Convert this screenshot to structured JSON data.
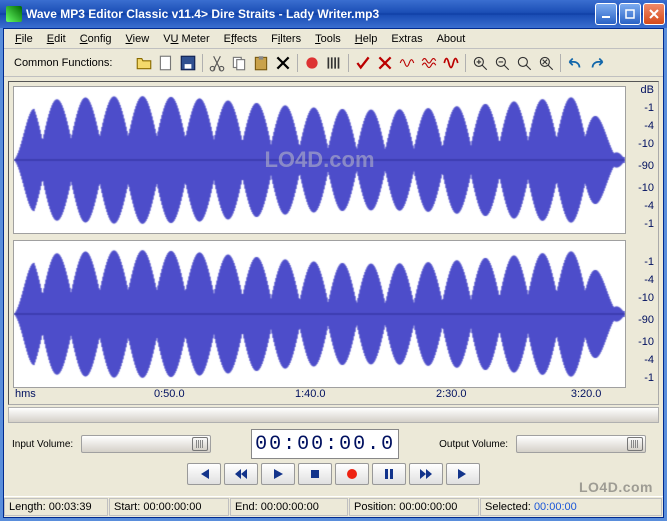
{
  "title": "Wave MP3 Editor Classic v11.4> Dire Straits - Lady Writer.mp3",
  "menu": [
    "File",
    "Edit",
    "Config",
    "View",
    "VU Meter",
    "Effects",
    "Filters",
    "Tools",
    "Help",
    "Extras",
    "About"
  ],
  "toolbar_label": "Common Functions:",
  "toolbar_icons": [
    "open",
    "new",
    "save",
    "cut",
    "copy",
    "paste",
    "delete",
    "record-region",
    "bars",
    "check",
    "cross",
    "wave1",
    "wave2",
    "wave3",
    "zoom-in",
    "zoom-out",
    "zoom-sel",
    "zoom-reset",
    "undo",
    "redo"
  ],
  "db_header": "dB",
  "db_scale": [
    "-1",
    "-4",
    "-10",
    "-90",
    "-10",
    "-4",
    "-1"
  ],
  "time_axis_label": "hms",
  "time_axis": [
    "0:50.0",
    "1:40.0",
    "2:30.0",
    "3:20.0"
  ],
  "input_volume_label": "Input Volume:",
  "output_volume_label": "Output Volume:",
  "counter": "00:00:00.0",
  "status": {
    "length_label": "Length:",
    "length": "00:03:39",
    "start_label": "Start:",
    "start": "00:00:00:00",
    "end_label": "End:",
    "end": "00:00:00:00",
    "position_label": "Position:",
    "position": "00:00:00:00",
    "selected_label": "Selected:",
    "selected": "00:00:00"
  },
  "watermark_center": "LO4D.com",
  "watermark": "LO4D.com"
}
